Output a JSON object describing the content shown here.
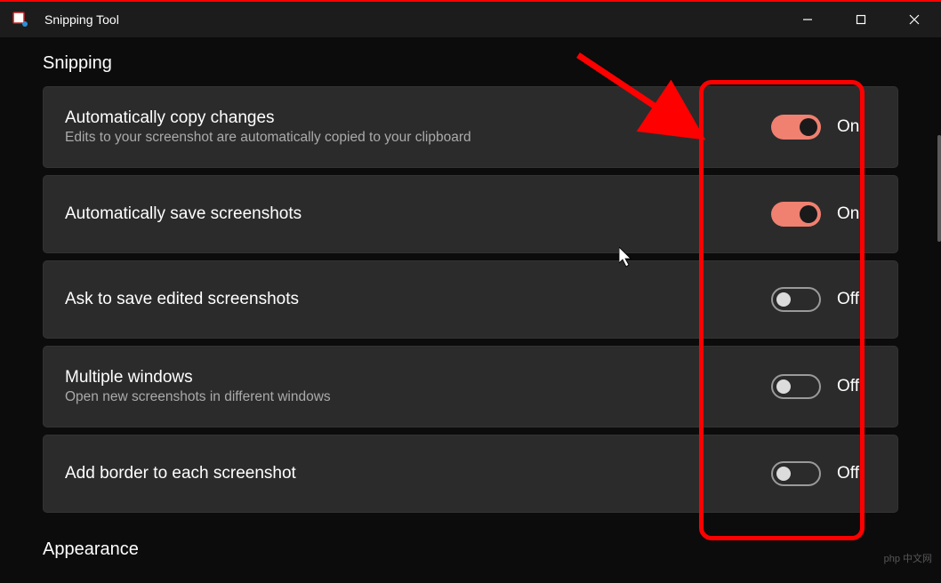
{
  "window": {
    "title": "Snipping Tool"
  },
  "sections": {
    "snipping": {
      "title": "Snipping",
      "rows": [
        {
          "title": "Automatically copy changes",
          "desc": "Edits to your screenshot are automatically copied to your clipboard",
          "state": "On",
          "on": true
        },
        {
          "title": "Automatically save screenshots",
          "desc": "",
          "state": "On",
          "on": true
        },
        {
          "title": "Ask to save edited screenshots",
          "desc": "",
          "state": "Off",
          "on": false
        },
        {
          "title": "Multiple windows",
          "desc": "Open new screenshots in different windows",
          "state": "Off",
          "on": false
        },
        {
          "title": "Add border to each screenshot",
          "desc": "",
          "state": "Off",
          "on": false
        }
      ]
    },
    "appearance": {
      "title": "Appearance"
    }
  },
  "watermark": "php 中文网"
}
